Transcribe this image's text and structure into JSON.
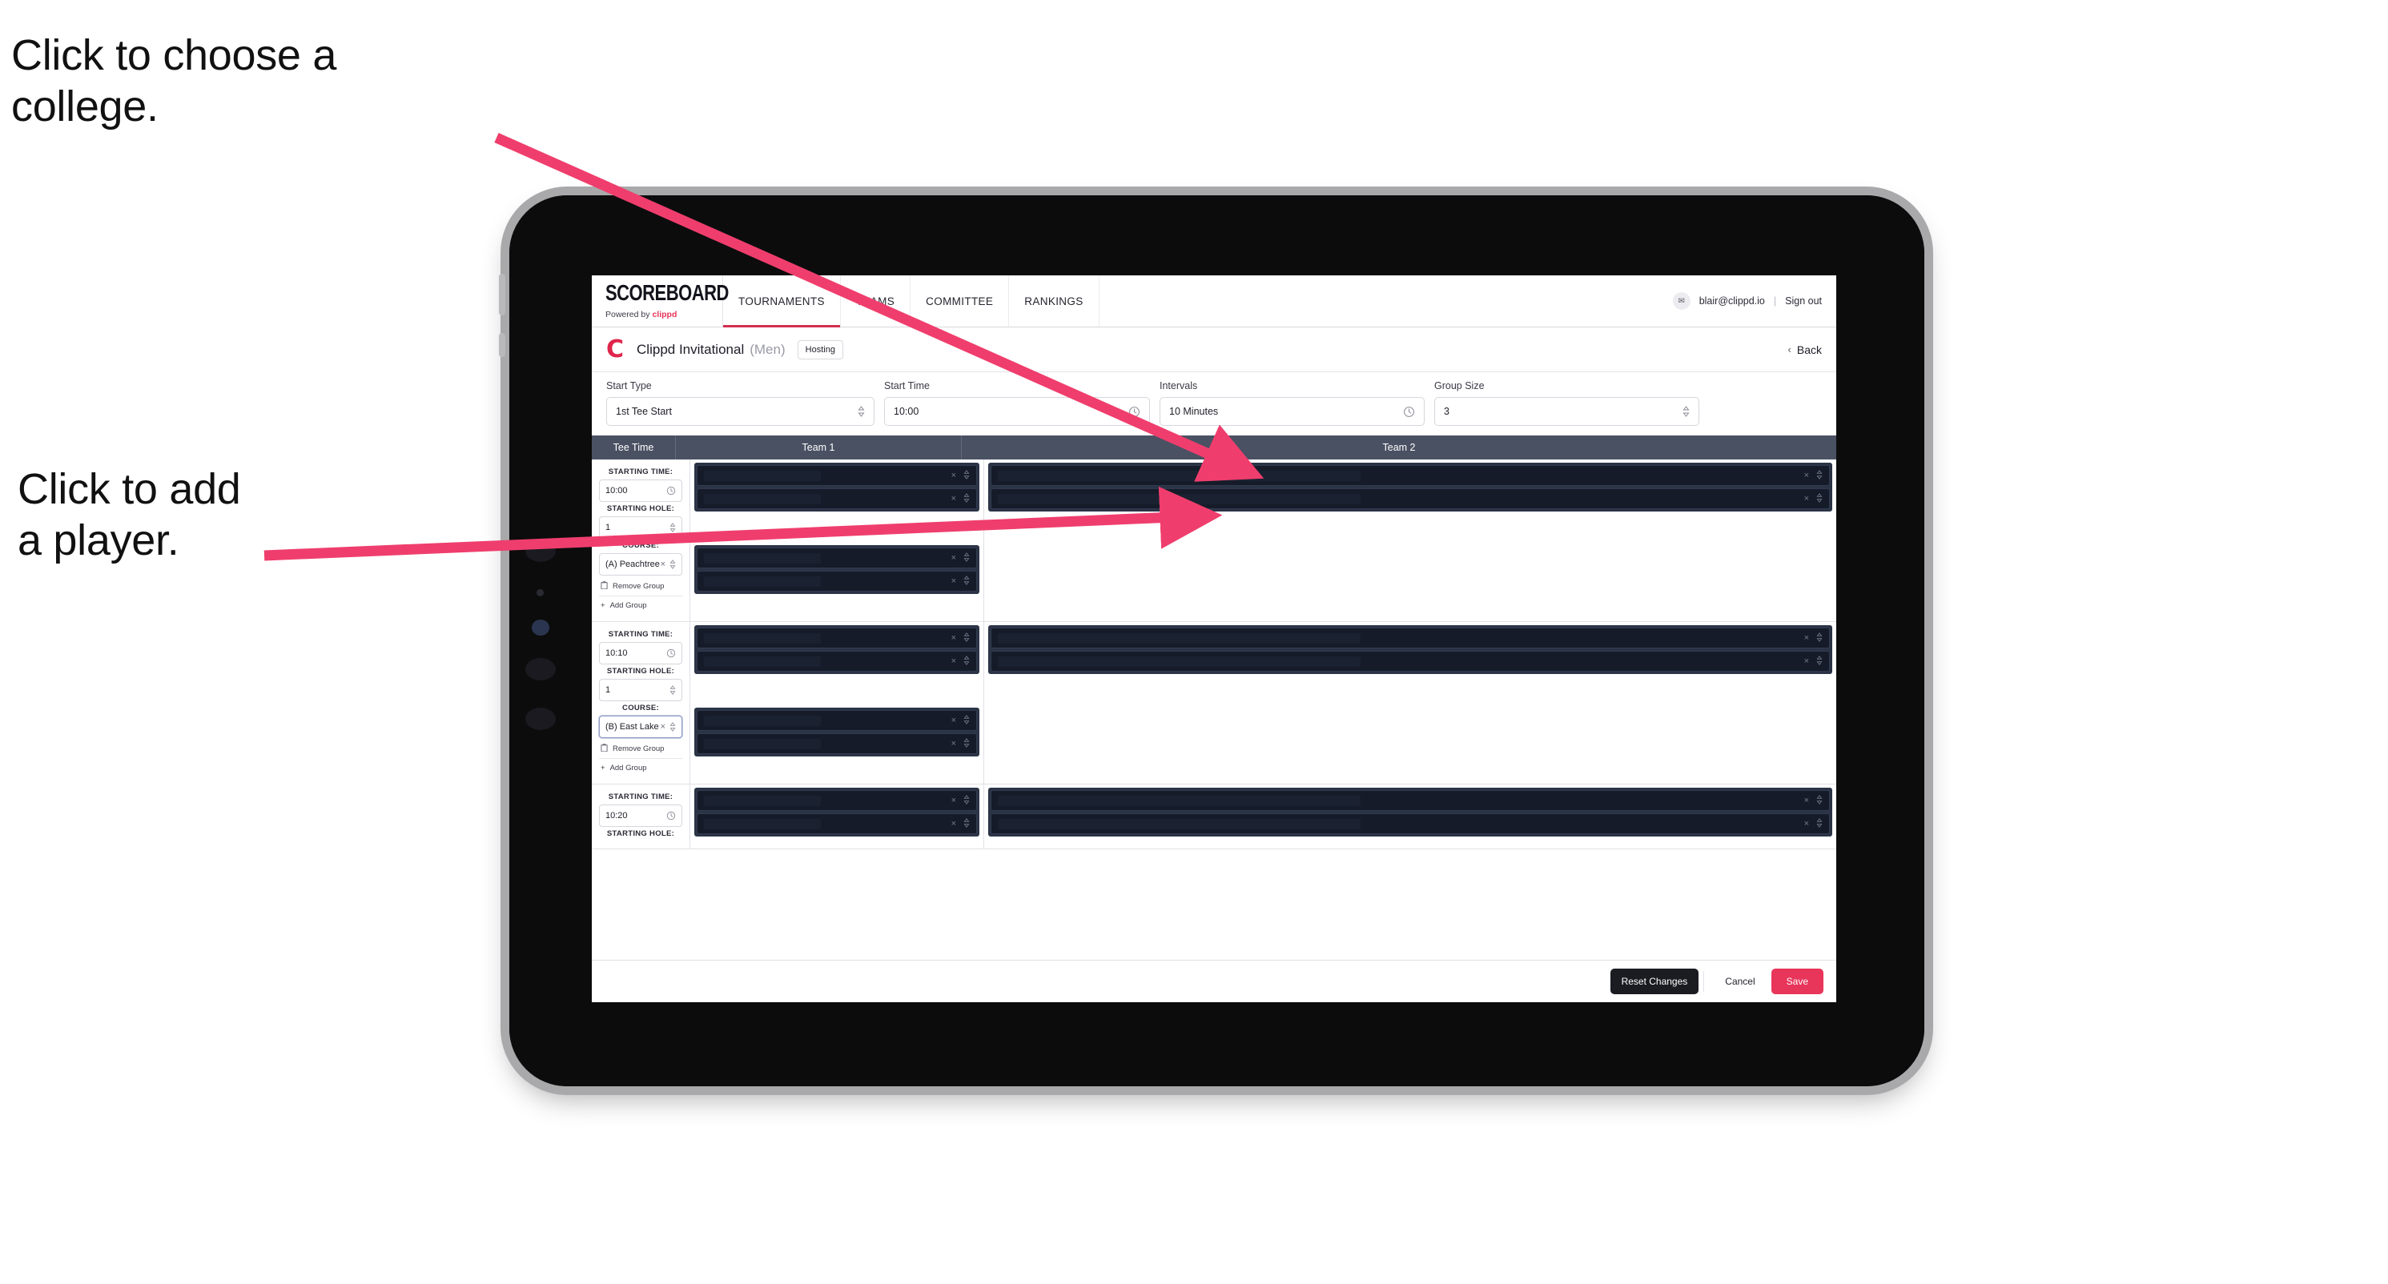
{
  "annotations": [
    {
      "id": "college",
      "text": "Click to choose a\ncollege."
    },
    {
      "id": "player",
      "text": "Click to add\na player."
    }
  ],
  "accent_colors": {
    "arrow_pink": "#ef3e6d",
    "brand_red": "#e8355a",
    "nav_underline": "#d32f4e",
    "table_header": "#4a5163",
    "player_row_bg": "#151b29",
    "group_box_bg": "#2b3446"
  },
  "app": {
    "topnav": {
      "brand": {
        "title": "SCOREBOARD",
        "powered_prefix": "Powered by",
        "powered_brand": "clippd"
      },
      "items": [
        {
          "label": "TOURNAMENTS",
          "active": true
        },
        {
          "label": "TEAMS",
          "active": false
        },
        {
          "label": "COMMITTEE",
          "active": false
        },
        {
          "label": "RANKINGS",
          "active": false
        }
      ],
      "account": {
        "avatar_glyph": "✉",
        "email": "blair@clippd.io",
        "separator": "|",
        "sign_out": "Sign out"
      }
    },
    "titlebar": {
      "logo_letter": "C",
      "tournament_name": "Clippd Invitational",
      "gender": "(Men)",
      "badge": "Hosting",
      "back_chevron": "‹",
      "back_label": "Back"
    },
    "controls": [
      {
        "label": "Start Type",
        "value": "1st Tee Start",
        "icon": "stepper-icon"
      },
      {
        "label": "Start Time",
        "value": "10:00",
        "icon": "clock-icon"
      },
      {
        "label": "Intervals",
        "value": "10 Minutes",
        "icon": "clock-icon"
      },
      {
        "label": "Group Size",
        "value": "3",
        "icon": "stepper-icon"
      }
    ],
    "table": {
      "headers": [
        "Tee Time",
        "Team 1",
        "Team 2"
      ],
      "field_labels": {
        "starting_time": "STARTING TIME:",
        "starting_hole": "STARTING HOLE:",
        "course": "COURSE:"
      },
      "group_actions": {
        "remove": "Remove Group",
        "add": "Add Group"
      },
      "row_icons": {
        "clear": "×",
        "stepper": "⇅",
        "trash": "trash-icon",
        "plus": "+"
      },
      "rows": [
        {
          "starting_time": "10:00",
          "starting_hole": "1",
          "course": "(A) Peachtree GC",
          "course_focused": false,
          "team1_groups": [
            {
              "players": 2
            },
            {
              "players": 2
            }
          ],
          "team2_groups": [
            {
              "players": 2
            }
          ]
        },
        {
          "starting_time": "10:10",
          "starting_hole": "1",
          "course": "(B) East Lake GC",
          "course_focused": true,
          "team1_groups": [
            {
              "players": 2
            },
            {
              "players": 2
            }
          ],
          "team2_groups": [
            {
              "players": 2
            }
          ]
        },
        {
          "starting_time": "10:20",
          "starting_hole": "",
          "course": "",
          "course_focused": false,
          "partial": true,
          "team1_groups": [
            {
              "players": 2
            }
          ],
          "team2_groups": [
            {
              "players": 2
            }
          ]
        }
      ]
    },
    "footer": {
      "reset": "Reset Changes",
      "cancel": "Cancel",
      "save": "Save"
    }
  }
}
